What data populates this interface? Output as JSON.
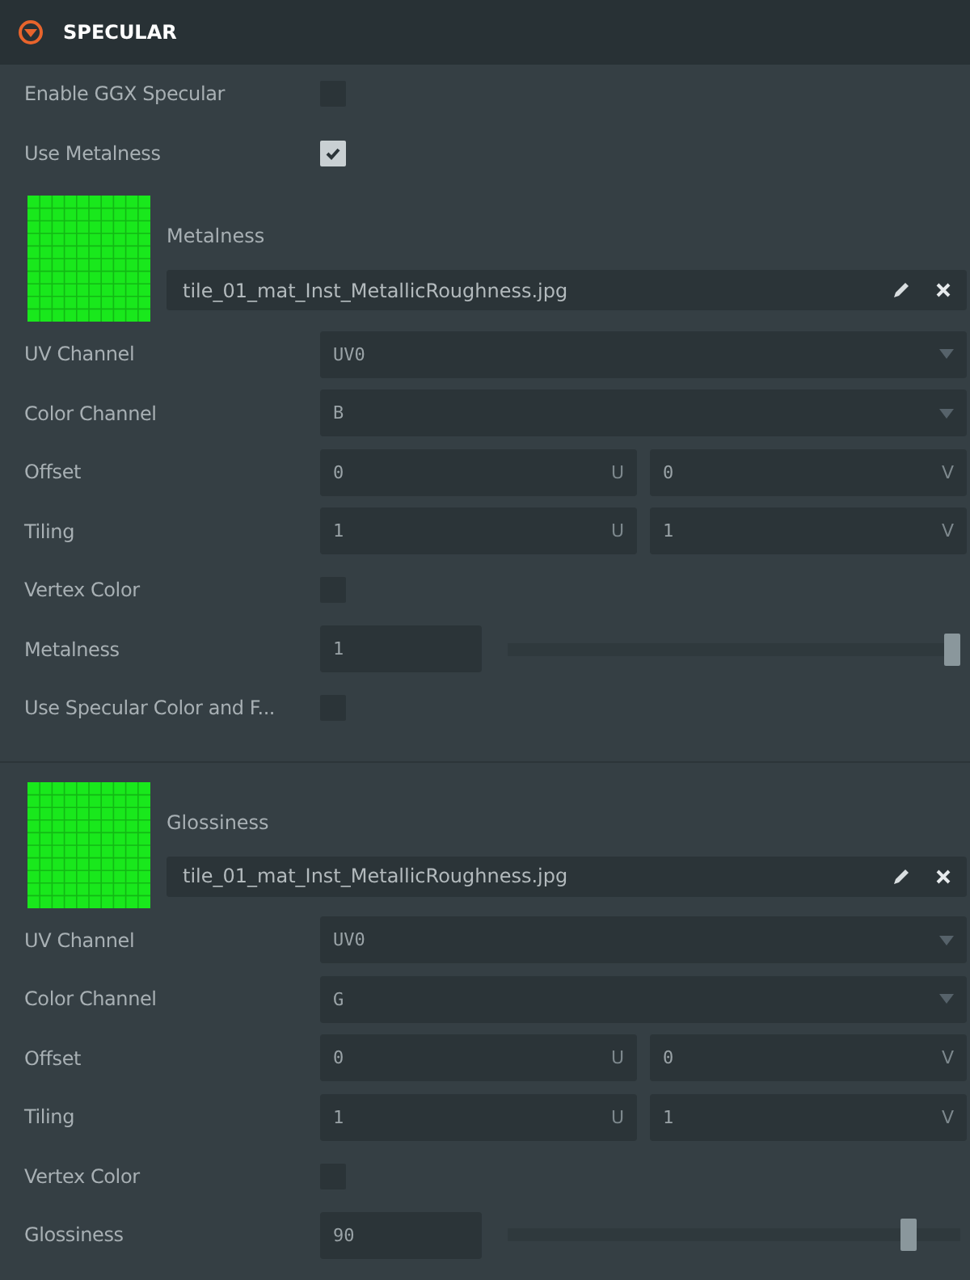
{
  "header": {
    "title": "SPECULAR",
    "expanded": true
  },
  "options": [
    {
      "kind": "checkbox",
      "label": "Enable GGX Specular",
      "checked": false
    },
    {
      "kind": "checkbox",
      "label": "Use Metalness",
      "checked": true
    }
  ],
  "maps": [
    {
      "label": "Metalness",
      "file": "tile_01_mat_Inst_MetallicRoughness.jpg",
      "properties": [
        {
          "kind": "dropdown",
          "label": "UV Channel",
          "value": "UV0"
        },
        {
          "kind": "dropdown",
          "label": "Color Channel",
          "value": "B"
        },
        {
          "kind": "vector2",
          "label": "Offset",
          "x": {
            "value": "0",
            "axis": "U"
          },
          "y": {
            "value": "0",
            "axis": "V"
          }
        },
        {
          "kind": "vector2",
          "label": "Tiling",
          "x": {
            "value": "1",
            "axis": "U"
          },
          "y": {
            "value": "1",
            "axis": "V"
          }
        },
        {
          "kind": "checkbox",
          "label": "Vertex Color",
          "checked": false
        },
        {
          "kind": "slider",
          "label": "Metalness",
          "value": "1",
          "level": 1
        },
        {
          "kind": "checkbox",
          "label": "Use Specular Color and F...",
          "checked": false
        }
      ]
    },
    {
      "label": "Glossiness",
      "file": "tile_01_mat_Inst_MetallicRoughness.jpg",
      "properties": [
        {
          "kind": "dropdown",
          "label": "UV Channel",
          "value": "UV0"
        },
        {
          "kind": "dropdown",
          "label": "Color Channel",
          "value": "G"
        },
        {
          "kind": "vector2",
          "label": "Offset",
          "x": {
            "value": "0",
            "axis": "U"
          },
          "y": {
            "value": "0",
            "axis": "V"
          }
        },
        {
          "kind": "vector2",
          "label": "Tiling",
          "x": {
            "value": "1",
            "axis": "U"
          },
          "y": {
            "value": "1",
            "axis": "V"
          }
        },
        {
          "kind": "checkbox",
          "label": "Vertex Color",
          "checked": false
        },
        {
          "kind": "slider",
          "label": "Glossiness",
          "value": "90",
          "level": 0.9
        }
      ]
    }
  ]
}
